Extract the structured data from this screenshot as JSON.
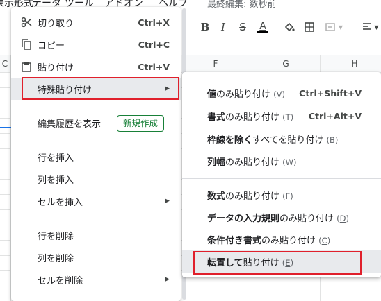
{
  "menubar": {
    "items": [
      "表示形式",
      "データ",
      "ツール",
      "アドオン",
      "ヘルプ"
    ],
    "last_edit": "最終編集: 数秒前"
  },
  "toolbar": {
    "icons": [
      "bold-icon",
      "italic-icon",
      "strikethrough-icon",
      "text-color-icon",
      "fill-color-icon",
      "borders-icon",
      "merge-cells-icon",
      "align-left-icon"
    ]
  },
  "sheet": {
    "columns": [
      "C",
      "F",
      "G",
      "H"
    ]
  },
  "main_menu": {
    "items": [
      {
        "icon": "scissors-icon",
        "label": "切り取り",
        "shortcut": "Ctrl+X"
      },
      {
        "icon": "copy-icon",
        "label": "コピー",
        "shortcut": "Ctrl+C"
      },
      {
        "icon": "paste-icon",
        "label": "貼り付け",
        "shortcut": "Ctrl+V"
      },
      {
        "label": "特殊貼り付け",
        "arrow": "▶"
      }
    ],
    "history_label": "編集履歴を表示",
    "new_badge": "新規作成",
    "insert": [
      {
        "label": "行を挿入"
      },
      {
        "label": "列を挿入"
      },
      {
        "label": "セルを挿入",
        "arrow": "▶"
      }
    ],
    "delete": [
      {
        "label": "行を削除"
      },
      {
        "label": "列を削除"
      },
      {
        "label": "セルを削除",
        "arrow": "▶"
      }
    ]
  },
  "submenu": {
    "items": [
      {
        "bold": "値",
        "rest": "のみ貼り付け",
        "key": "V",
        "shortcut": "Ctrl+Shift+V"
      },
      {
        "bold": "書式",
        "rest": "のみ貼り付け",
        "key": "T",
        "shortcut": "Ctrl+Alt+V"
      },
      {
        "bold": "枠線を除く",
        "rest": "すべてを貼り付け",
        "key": "B"
      },
      {
        "bold": "列幅",
        "rest": "のみ貼り付け",
        "key": "W"
      },
      {
        "bold": "数式",
        "rest": "のみ貼り付け",
        "key": "F"
      },
      {
        "bold": "データの入力規則",
        "rest": "のみ貼り付け",
        "key": "D"
      },
      {
        "bold": "条件付き書式",
        "rest": "のみ貼り付け",
        "key": "C"
      },
      {
        "bold": "転置して",
        "rest": "貼り付け",
        "key": "E"
      }
    ]
  },
  "colors": {
    "highlight_border": "#e0202c",
    "new_badge": "#188038",
    "hover_bg": "#e8eaed"
  }
}
